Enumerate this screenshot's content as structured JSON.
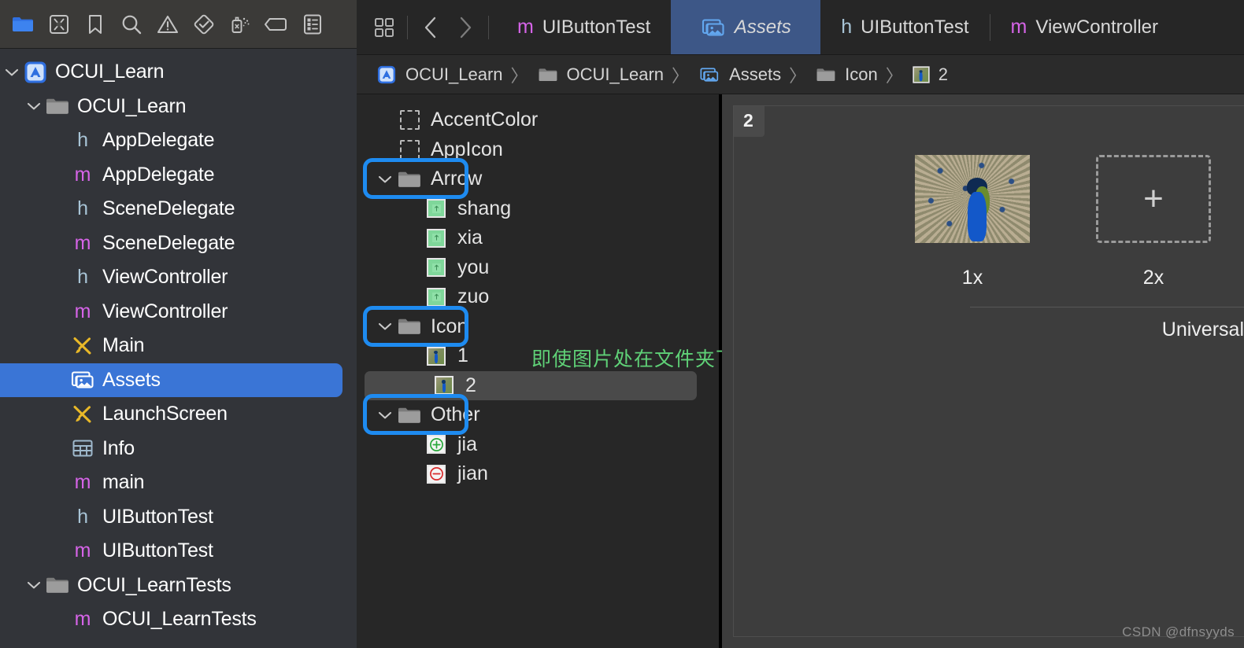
{
  "navigator": {
    "toolbar_icons": [
      {
        "name": "project-navigator-icon",
        "label": "Project",
        "active": true
      },
      {
        "name": "source-control-navigator-icon",
        "label": "Source Control",
        "active": false
      },
      {
        "name": "bookmark-navigator-icon",
        "label": "Bookmarks",
        "active": false
      },
      {
        "name": "find-navigator-icon",
        "label": "Find",
        "active": false
      },
      {
        "name": "issue-navigator-icon",
        "label": "Issues",
        "active": false
      },
      {
        "name": "test-navigator-icon",
        "label": "Tests",
        "active": false
      },
      {
        "name": "debug-navigator-icon",
        "label": "Debug",
        "active": false
      },
      {
        "name": "breakpoint-navigator-icon",
        "label": "Breakpoints",
        "active": false
      },
      {
        "name": "report-navigator-icon",
        "label": "Reports",
        "active": false
      }
    ],
    "tree": [
      {
        "label": "OCUI_Learn",
        "icon": "xcode-project-icon",
        "depth": 0,
        "disclosure": "open",
        "selected": false
      },
      {
        "label": "OCUI_Learn",
        "icon": "folder-icon",
        "depth": 1,
        "disclosure": "open",
        "selected": false
      },
      {
        "label": "AppDelegate",
        "icon": "h-file-icon",
        "depth": 2,
        "disclosure": "",
        "selected": false
      },
      {
        "label": "AppDelegate",
        "icon": "m-file-icon",
        "depth": 2,
        "disclosure": "",
        "selected": false
      },
      {
        "label": "SceneDelegate",
        "icon": "h-file-icon",
        "depth": 2,
        "disclosure": "",
        "selected": false
      },
      {
        "label": "SceneDelegate",
        "icon": "m-file-icon",
        "depth": 2,
        "disclosure": "",
        "selected": false
      },
      {
        "label": "ViewController",
        "icon": "h-file-icon",
        "depth": 2,
        "disclosure": "",
        "selected": false
      },
      {
        "label": "ViewController",
        "icon": "m-file-icon",
        "depth": 2,
        "disclosure": "",
        "selected": false
      },
      {
        "label": "Main",
        "icon": "storyboard-icon",
        "depth": 2,
        "disclosure": "",
        "selected": false
      },
      {
        "label": "Assets",
        "icon": "assets-icon",
        "depth": 2,
        "disclosure": "",
        "selected": true
      },
      {
        "label": "LaunchScreen",
        "icon": "storyboard-icon",
        "depth": 2,
        "disclosure": "",
        "selected": false
      },
      {
        "label": "Info",
        "icon": "plist-icon",
        "depth": 2,
        "disclosure": "",
        "selected": false
      },
      {
        "label": "main",
        "icon": "m-file-icon",
        "depth": 2,
        "disclosure": "",
        "selected": false
      },
      {
        "label": "UIButtonTest",
        "icon": "h-file-icon",
        "depth": 2,
        "disclosure": "",
        "selected": false
      },
      {
        "label": "UIButtonTest",
        "icon": "m-file-icon",
        "depth": 2,
        "disclosure": "",
        "selected": false
      },
      {
        "label": "OCUI_LearnTests",
        "icon": "folder-icon",
        "depth": 1,
        "disclosure": "open",
        "selected": false
      },
      {
        "label": "OCUI_LearnTests",
        "icon": "m-file-icon",
        "depth": 2,
        "disclosure": "",
        "selected": false
      }
    ]
  },
  "editor": {
    "tabs": [
      {
        "label": "UIButtonTest",
        "icon": "m-file-icon",
        "active": false
      },
      {
        "label": "Assets",
        "icon": "assets-icon",
        "active": true
      },
      {
        "label": "UIButtonTest",
        "icon": "h-file-icon",
        "active": false
      },
      {
        "label": "ViewController",
        "icon": "m-file-icon",
        "active": false
      }
    ],
    "nav_back_icon": "chevron-left-icon",
    "nav_forward_icon": "chevron-right-icon",
    "grid_icon": "editor-grid-icon",
    "breadcrumb": [
      {
        "label": "OCUI_Learn",
        "icon": "xcode-project-icon"
      },
      {
        "label": "OCUI_Learn",
        "icon": "folder-icon"
      },
      {
        "label": "Assets",
        "icon": "assets-icon"
      },
      {
        "label": "Icon",
        "icon": "folder-icon"
      },
      {
        "label": "2",
        "icon": "image-thumb-icon"
      }
    ],
    "breadcrumb_separator": "〉"
  },
  "asset_list": [
    {
      "label": "AccentColor",
      "icon": "color-swatch-icon",
      "depth": 0,
      "disclosure": "",
      "selected": false
    },
    {
      "label": "AppIcon",
      "icon": "color-swatch-icon",
      "depth": 0,
      "disclosure": "",
      "selected": false
    },
    {
      "label": "Arrow",
      "icon": "folder-icon",
      "depth": 0,
      "disclosure": "open",
      "selected": false,
      "highlight": true
    },
    {
      "label": "shang",
      "icon": "green-arrow-thumb-icon",
      "depth": 1,
      "disclosure": "",
      "selected": false
    },
    {
      "label": "xia",
      "icon": "green-arrow-thumb-icon",
      "depth": 1,
      "disclosure": "",
      "selected": false
    },
    {
      "label": "you",
      "icon": "green-arrow-thumb-icon",
      "depth": 1,
      "disclosure": "",
      "selected": false
    },
    {
      "label": "zuo",
      "icon": "green-arrow-thumb-icon",
      "depth": 1,
      "disclosure": "",
      "selected": false
    },
    {
      "label": "Icon",
      "icon": "folder-icon",
      "depth": 0,
      "disclosure": "open",
      "selected": false,
      "highlight": true
    },
    {
      "label": "1",
      "icon": "peacock-thumb-icon",
      "depth": 1,
      "disclosure": "",
      "selected": false
    },
    {
      "label": "2",
      "icon": "peacock-thumb-icon",
      "depth": 1,
      "disclosure": "",
      "selected": true
    },
    {
      "label": "Other",
      "icon": "folder-icon",
      "depth": 0,
      "disclosure": "open",
      "selected": false,
      "highlight": true
    },
    {
      "label": "jia",
      "icon": "plus-circle-green-icon",
      "depth": 1,
      "disclosure": "",
      "selected": false
    },
    {
      "label": "jian",
      "icon": "minus-circle-red-icon",
      "depth": 1,
      "disclosure": "",
      "selected": false
    }
  ],
  "annotation": {
    "text": "即使图片处在文件夹下，仍可直接用名称访问到",
    "color": "#5fd177",
    "highlight_color": "#1e8bf0"
  },
  "detail": {
    "title": "2",
    "slots": [
      {
        "scale": "1x",
        "filled": true,
        "icon": "peacock-image"
      },
      {
        "scale": "2x",
        "filled": false,
        "icon": "add-placeholder-icon",
        "plus": "+"
      }
    ],
    "idiom": "Universal"
  },
  "watermark": "CSDN @dfnsyyds"
}
